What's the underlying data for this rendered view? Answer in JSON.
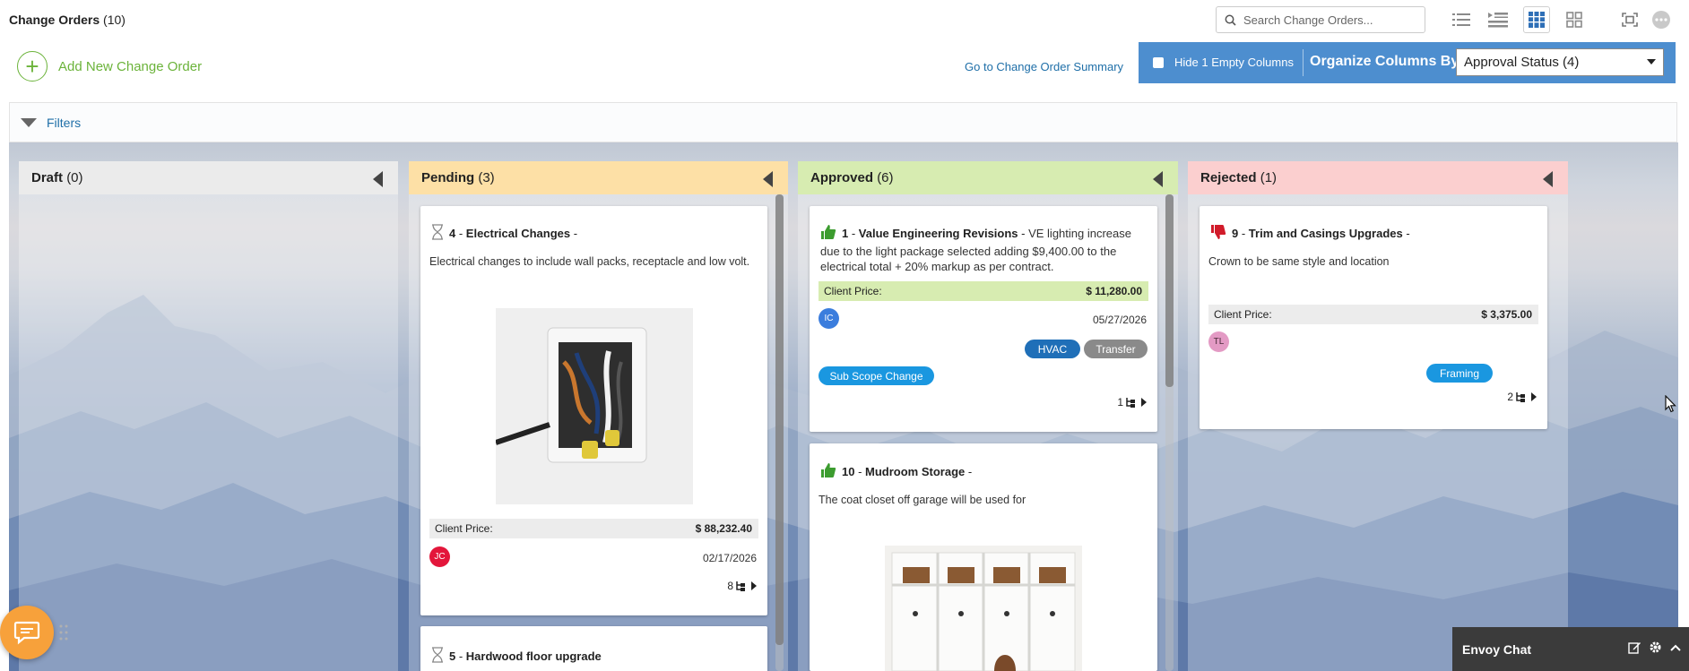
{
  "header": {
    "title": "Change Orders",
    "count": "(10)",
    "search_placeholder": "Search Change Orders...",
    "view_icons": [
      "list-compact-icon",
      "list-detail-icon",
      "board-view-icon",
      "grid-view-icon",
      "fullscreen-icon",
      "more-icon"
    ]
  },
  "actions": {
    "add_label": "Add New Change Order",
    "summary_link": "Go to Change Order Summary",
    "hide_label": "Hide 1 Empty Columns",
    "organize_label": "Organize Columns By",
    "organize_value": "Approval Status (4)"
  },
  "filters": {
    "label": "Filters"
  },
  "columns": [
    {
      "name": "Draft",
      "count": "(0)",
      "color": "#ebebeb"
    },
    {
      "name": "Pending",
      "count": "(3)",
      "color": "#fde0a6"
    },
    {
      "name": "Approved",
      "count": "(6)",
      "color": "#d7ecb1"
    },
    {
      "name": "Rejected",
      "count": "(1)",
      "color": "#fbcfcf"
    }
  ],
  "cards": {
    "pending": [
      {
        "status_icon": "hourglass-icon",
        "number": "4",
        "title": "Electrical Changes",
        "description": "Electrical changes to include wall packs, receptacle and low volt.",
        "photo": "electrical-box-photo",
        "price_label": "Client Price:",
        "price": "$ 88,232.40",
        "avatar": "JC",
        "avatar_color": "#e3163b",
        "date": "02/17/2026",
        "sub_count": "8"
      },
      {
        "status_icon": "hourglass-icon",
        "number": "5",
        "title": "Hardwood floor upgrade"
      }
    ],
    "approved": [
      {
        "status_icon": "thumbs-up-icon",
        "number": "1",
        "title": "Value Engineering Revisions",
        "description": "VE lighting increase due to the light package selected adding $9,400.00 to the electrical total + 20% markup as per contract.",
        "price_label": "Client Price:",
        "price": "$ 11,280.00",
        "avatar": "IC",
        "avatar_color": "#3b7ddd",
        "date": "05/27/2026",
        "tags": [
          {
            "label": "HVAC",
            "color": "#1f6fb8"
          },
          {
            "label": "Transfer",
            "color": "#8a8a8a"
          },
          {
            "label": "Sub Scope Change",
            "color": "#1a97e0"
          }
        ],
        "sub_count": "1"
      },
      {
        "status_icon": "thumbs-up-icon",
        "number": "10",
        "title": "Mudroom Storage",
        "description": "The coat closet off garage will be used for",
        "photo": "mudroom-cubbies-photo"
      }
    ],
    "rejected": [
      {
        "status_icon": "thumbs-down-icon",
        "number": "9",
        "title": "Trim and Casings Upgrades",
        "description": "Crown to be same style and location",
        "price_label": "Client Price:",
        "price": "$ 3,375.00",
        "avatar": "TL",
        "avatar_color": "#e39ac4",
        "tags": [
          {
            "label": "Framing",
            "color": "#1a97e0"
          }
        ],
        "sub_count": "2"
      }
    ]
  },
  "chat": {
    "title": "Envoy Chat"
  }
}
